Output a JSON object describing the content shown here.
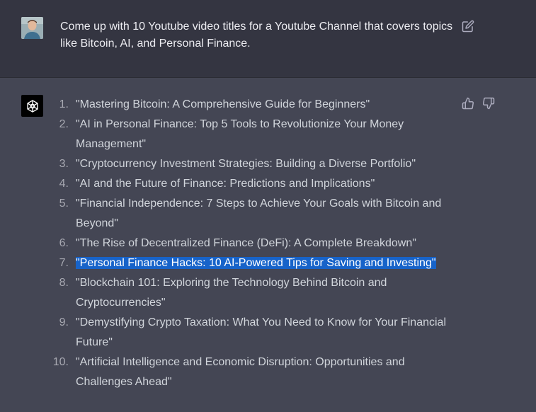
{
  "prompt": {
    "text": "Come up with 10 Youtube video titles for a Youtube Channel that covers topics like Bitcoin, AI, and Personal Finance.",
    "user_avatar_icon": "user-avatar",
    "edit_icon": "edit-icon"
  },
  "response": {
    "assistant_icon": "openai-logo-icon",
    "highlight_color": "#1763c9",
    "items": [
      {
        "num": "1.",
        "text": "\"Mastering Bitcoin: A Comprehensive Guide for Beginners\""
      },
      {
        "num": "2.",
        "text": "\"AI in Personal Finance: Top 5 Tools to Revolutionize Your Money Management\""
      },
      {
        "num": "3.",
        "text": "\"Cryptocurrency Investment Strategies: Building a Diverse Portfolio\""
      },
      {
        "num": "4.",
        "text": "\"AI and the Future of Finance: Predictions and Implications\""
      },
      {
        "num": "5.",
        "text": "\"Financial Independence: 7 Steps to Achieve Your Goals with Bitcoin and Beyond\""
      },
      {
        "num": "6.",
        "text": "\"The Rise of Decentralized Finance (DeFi): A Complete Breakdown\""
      },
      {
        "num": "7.",
        "text": "\"Personal Finance Hacks: 10 AI-Powered Tips for Saving and Investing\""
      },
      {
        "num": "8.",
        "text": "\"Blockchain 101: Exploring the Technology Behind Bitcoin and Cryptocurrencies\""
      },
      {
        "num": "9.",
        "text": "\"Demystifying Crypto Taxation: What You Need to Know for Your Financial Future\""
      },
      {
        "num": "10.",
        "text": "\"Artificial Intelligence and Economic Disruption: Opportunities and Challenges Ahead\""
      }
    ]
  }
}
